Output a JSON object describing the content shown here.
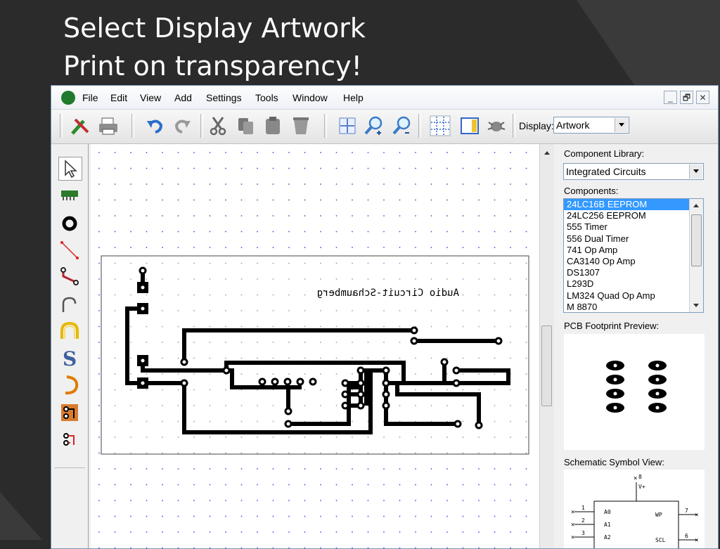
{
  "slide": {
    "title_line1": "Select Display Artwork",
    "title_line2": " Print on transparency!"
  },
  "menu": [
    "File",
    "Edit",
    "View",
    "Add",
    "Settings",
    "Tools",
    "Window",
    "Help"
  ],
  "window_buttons": {
    "minimize": "_",
    "restore": "🗗",
    "close": "✕"
  },
  "toolbar": {
    "display_label": "Display:",
    "display_value": "Artwork"
  },
  "panel": {
    "library_label": "Component Library:",
    "library_value": "Integrated Circuits",
    "components_label": "Components:",
    "components": [
      "24LC16B EEPROM",
      "24LC256 EEPROM",
      "555 Timer",
      "556 Dual Timer",
      "741 Op Amp",
      "CA3140 Op Amp",
      "DS1307",
      "L293D",
      "LM324 Quad Op Amp",
      "M 8870"
    ],
    "selected_index": 0,
    "footprint_label": "PCB Footprint Preview:",
    "schematic_label": "Schematic Symbol View:"
  },
  "board": {
    "text": "Audio Circuit-Schaumberg"
  },
  "schematic": {
    "top_pin_number": "8",
    "top_pin_name": "V+",
    "left_pins": [
      {
        "num": "1",
        "name": "A0"
      },
      {
        "num": "2",
        "name": "A1"
      },
      {
        "num": "3",
        "name": "A2"
      }
    ],
    "right_pins": [
      {
        "num": "7",
        "name": "WP"
      },
      {
        "num": "6",
        "name": "SCL"
      }
    ]
  },
  "colors": {
    "background": "#2b2b2b",
    "selection": "#3399ff",
    "trace": "#000000"
  }
}
